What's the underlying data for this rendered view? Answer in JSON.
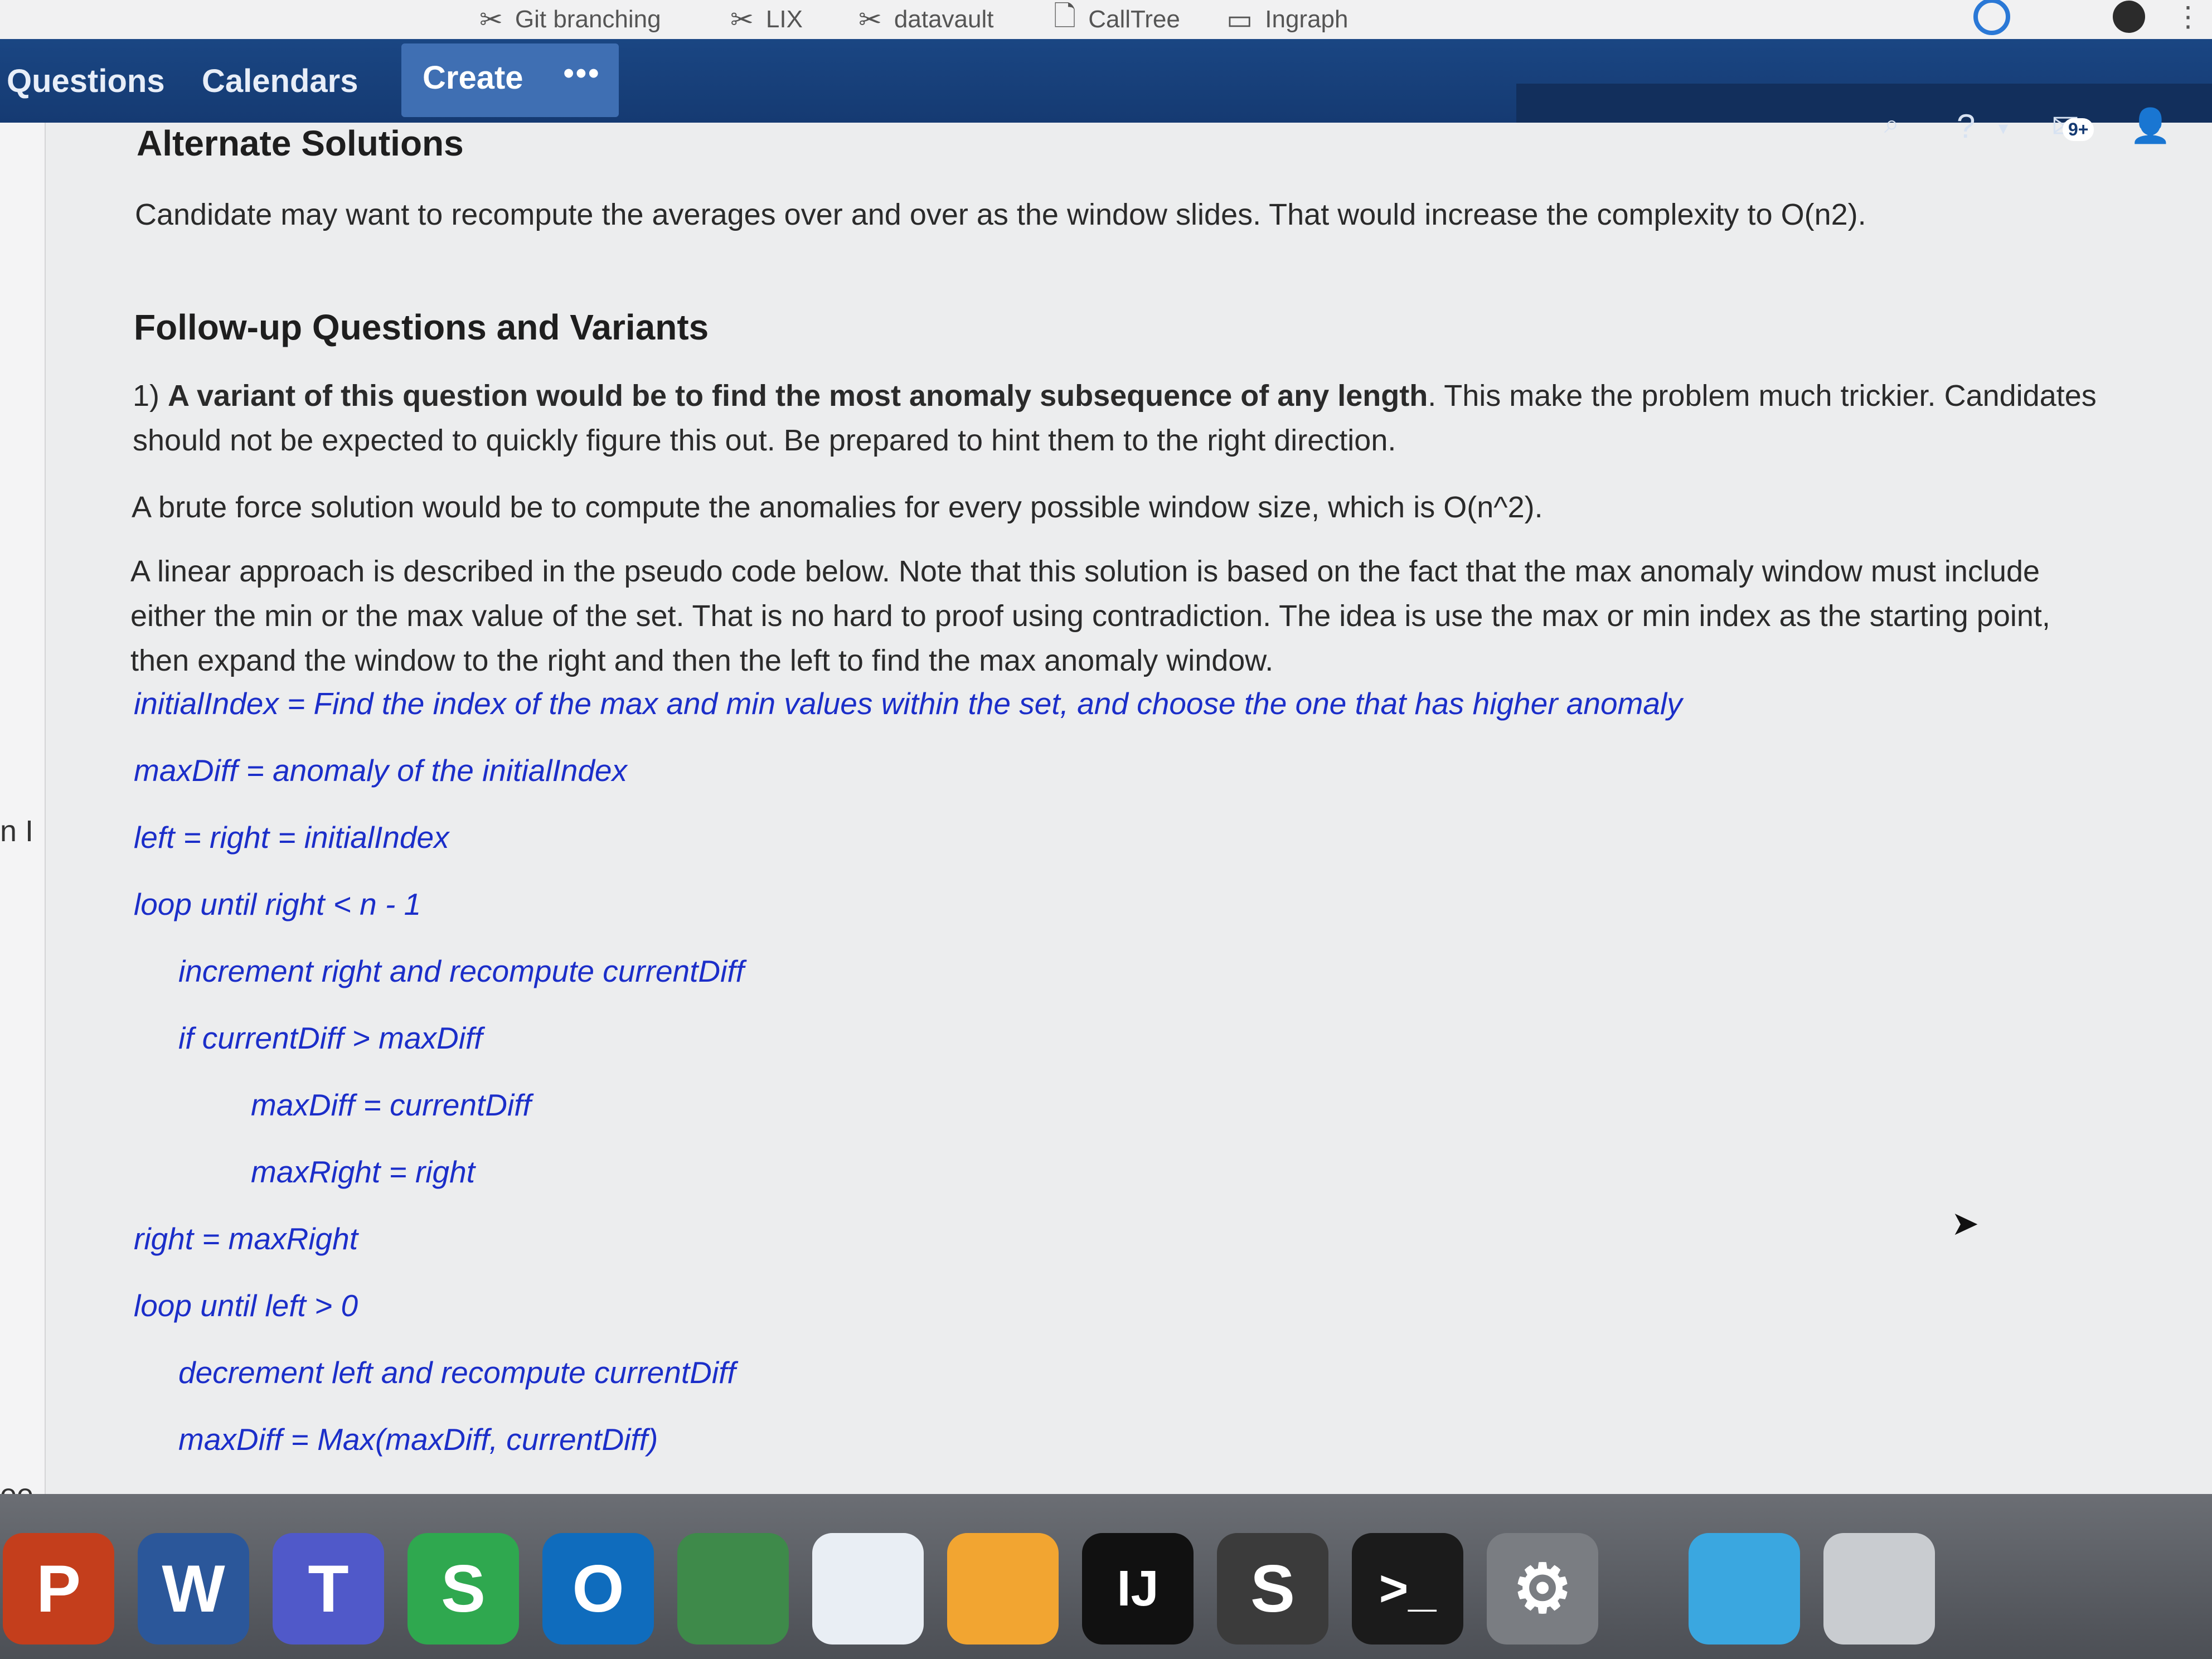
{
  "bookmarks": [
    {
      "icon": "tools-icon",
      "label": "Git branching"
    },
    {
      "icon": "tools-icon",
      "label": "LIX"
    },
    {
      "icon": "tools-icon",
      "label": "datavault"
    },
    {
      "icon": "page-icon",
      "label": "CallTree"
    },
    {
      "icon": "folder-icon",
      "label": "Ingraph"
    }
  ],
  "nav": {
    "items": [
      "Questions",
      "Calendars"
    ],
    "create_label": "Create",
    "more_label": "•••",
    "notification_count": "9+",
    "icons": [
      "search-icon",
      "help-icon",
      "notifications-icon",
      "user-icon"
    ]
  },
  "sidebar_fragments": [
    "n I",
    "ee",
    "<"
  ],
  "content": {
    "alt_heading": "Alternate Solutions",
    "alt_paragraph": "Candidate may want to recompute the averages over and over as the window slides. That would increase the complexity to O(n2).",
    "followup_heading": "Follow-up Questions and Variants",
    "variant_prefix": "1) ",
    "variant_bold": "A variant of this question would be to find the most anomaly subsequence of any length",
    "variant_rest": ". This make the problem much trickier. Candidates should not be expected to quickly figure this out. Be prepared to hint them to the right direction.",
    "brute_force": "A brute force solution would be to compute the anomalies for every possible window size, which is O(n^2).",
    "linear_approach": "A linear approach is described in the pseudo code below. Note that this solution is based on the fact that the max anomaly window must include either the min or the max value of the set. That is no hard to proof using contradiction. The idea is use the max or min index as the starting point, then expand the window to the right and then the left to find the max anomaly window.",
    "pseudo_code": [
      {
        "indent": 0,
        "text": "initialIndex = Find the index of the max and min values within the set, and choose the one that has higher anomaly"
      },
      {
        "indent": 0,
        "text": "maxDiff = anomaly of the initialIndex"
      },
      {
        "indent": 0,
        "text": "left = right = initialIndex"
      },
      {
        "indent": 0,
        "text": "loop until right < n - 1"
      },
      {
        "indent": 1,
        "text": "increment right and recompute currentDiff"
      },
      {
        "indent": 1,
        "text": "if  currentDiff > maxDiff"
      },
      {
        "indent": 2,
        "text": "maxDiff = currentDiff"
      },
      {
        "indent": 2,
        "text": "maxRight = right"
      },
      {
        "indent": 0,
        "text": "right = maxRight"
      },
      {
        "indent": 0,
        "text": "loop until left > 0"
      },
      {
        "indent": 1,
        "text": "decrement left and recompute currentDiff"
      },
      {
        "indent": 1,
        "text": "maxDiff = Max(maxDiff, currentDiff)"
      }
    ]
  },
  "dock": [
    {
      "name": "powerpoint",
      "label": "P",
      "color": "#c43e1c"
    },
    {
      "name": "word",
      "label": "W",
      "color": "#2b579a"
    },
    {
      "name": "teams",
      "label": "T",
      "color": "#5059c9"
    },
    {
      "name": "skype",
      "label": "S",
      "color": "#2fa84f"
    },
    {
      "name": "outlook",
      "label": "O",
      "color": "#0f6cbd"
    },
    {
      "name": "vpn",
      "label": "",
      "color": "#3e8a4a"
    },
    {
      "name": "wifi",
      "label": "",
      "color": "#e9eef4"
    },
    {
      "name": "self-service",
      "label": "",
      "color": "#f2a531"
    },
    {
      "name": "intellij",
      "label": "IJ",
      "color": "#111111"
    },
    {
      "name": "sublime",
      "label": "S",
      "color": "#3b3b3b"
    },
    {
      "name": "terminal",
      "label": ">_",
      "color": "#1b1b1b"
    },
    {
      "name": "system-preferences",
      "label": "⚙",
      "color": "#7a7d82"
    },
    {
      "name": "downloads",
      "label": "",
      "color": "#3aa7e0"
    },
    {
      "name": "trash",
      "label": "",
      "color": "#c9ccd0"
    }
  ]
}
